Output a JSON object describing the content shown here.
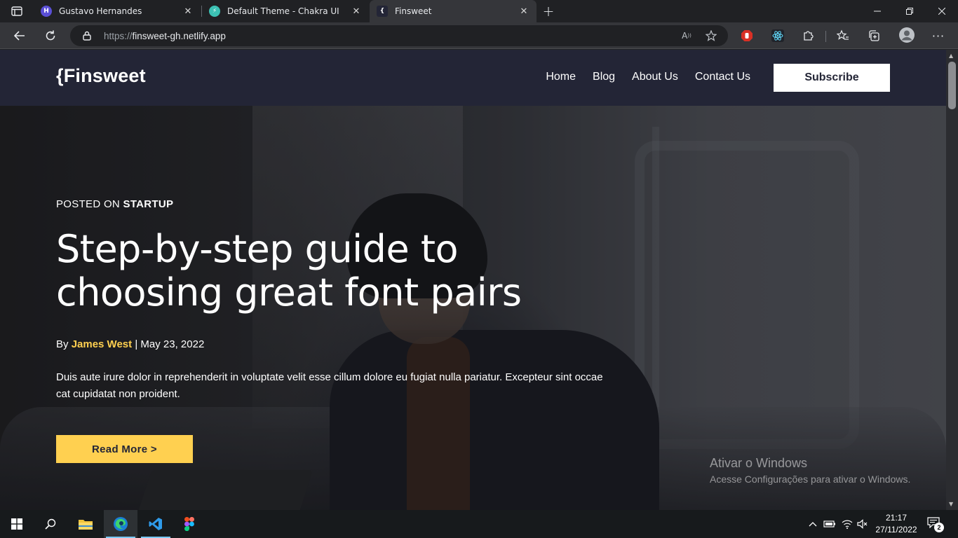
{
  "browser": {
    "tabs": [
      {
        "title": "Gustavo Hernandes",
        "favicon": "H",
        "favicon_color": "#5a4fd6",
        "active": false
      },
      {
        "title": "Default Theme - Chakra UI",
        "favicon": "⚡",
        "favicon_color": "#3cc1b4",
        "active": false
      },
      {
        "title": "Finsweet",
        "favicon": "{",
        "favicon_color": "#232536",
        "active": true
      }
    ],
    "new_tab_label": "+",
    "address": {
      "scheme": "https://",
      "host": "finsweet-gh.netlify.app"
    }
  },
  "site": {
    "logo": "{Finsweet",
    "nav": [
      "Home",
      "Blog",
      "About Us",
      "Contact Us"
    ],
    "subscribe_label": "Subscribe"
  },
  "hero": {
    "posted_prefix": "POSTED ON",
    "category": "STARTUP",
    "title": "Step-by-step guide to choosing great font pairs",
    "by_prefix": "By",
    "author": "James West",
    "date_sep": "|",
    "date": "May 23, 2022",
    "excerpt": "Duis aute irure dolor in reprehenderit in voluptate velit esse cillum dolore eu fugiat nulla pariatur. Excepteur sint occae cat cupidatat non proident.",
    "read_more_label": "Read More >"
  },
  "watermark": {
    "line1": "Ativar o Windows",
    "line2": "Acesse Configurações para ativar o Windows."
  },
  "taskbar": {
    "time": "21:17",
    "date": "27/11/2022",
    "notifications": "2"
  },
  "colors": {
    "accent_yellow": "#ffd050",
    "site_dark": "#232536",
    "browser_dark": "#202124"
  }
}
